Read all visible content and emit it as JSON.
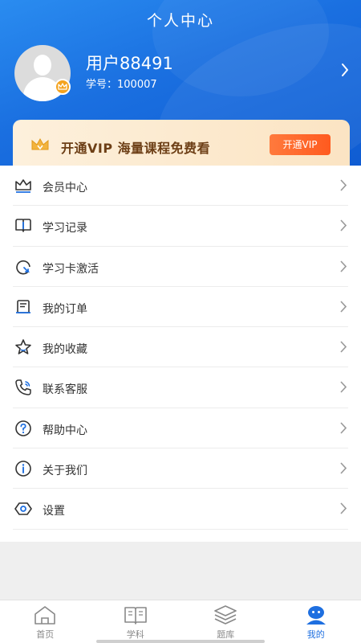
{
  "header": {
    "title": "个人中心",
    "username": "用户88491",
    "student_id": "学号：100007"
  },
  "vip": {
    "text": "开通VIP 海量课程免费看",
    "button_label": "开通VIP"
  },
  "menu": [
    {
      "label": "会员中心",
      "icon": "crown-icon"
    },
    {
      "label": "学习记录",
      "icon": "book-icon"
    },
    {
      "label": "学习卡激活",
      "icon": "activate-icon"
    },
    {
      "label": "我的订单",
      "icon": "order-icon"
    },
    {
      "label": "我的收藏",
      "icon": "star-icon"
    },
    {
      "label": "联系客服",
      "icon": "phone-icon"
    },
    {
      "label": "帮助中心",
      "icon": "help-icon"
    },
    {
      "label": "关于我们",
      "icon": "info-icon"
    },
    {
      "label": "设置",
      "icon": "settings-icon"
    }
  ],
  "tabs": [
    {
      "label": "首页",
      "icon": "home-icon"
    },
    {
      "label": "学科",
      "icon": "subject-icon"
    },
    {
      "label": "题库",
      "icon": "layers-icon"
    },
    {
      "label": "我的",
      "icon": "profile-icon",
      "active": true
    }
  ],
  "colors": {
    "brand_blue": "#1a6fe0",
    "vip_orange": "#ff5a1f",
    "vip_text": "#6d3f16"
  }
}
